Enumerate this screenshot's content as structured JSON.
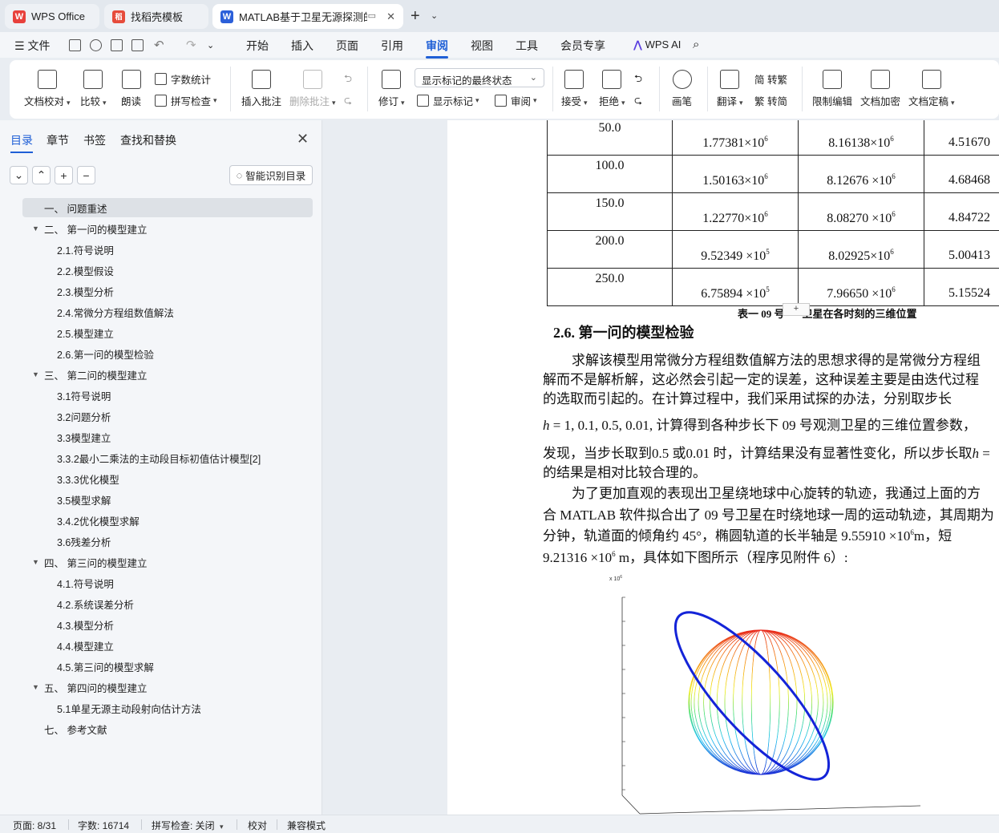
{
  "tabs": [
    {
      "label": "WPS Office",
      "logo": "W"
    },
    {
      "label": "找稻壳模板",
      "logo": "稻"
    },
    {
      "label": "MATLAB基于卫星无源探测的空...",
      "logo": "W"
    }
  ],
  "menu": {
    "file": "文件",
    "items": [
      "开始",
      "插入",
      "页面",
      "引用",
      "审阅",
      "视图",
      "工具",
      "会员专享"
    ],
    "active": "审阅",
    "ai": "WPS AI"
  },
  "ribbon": {
    "doc_check": "文档校对",
    "compare": "比较",
    "read_aloud": "朗读",
    "word_count": "字数统计",
    "spell_check": "拼写检查",
    "insert_comment": "插入批注",
    "delete_comment": "删除批注",
    "revise": "修订",
    "markup_select": "显示标记的最终状态",
    "show_markup": "显示标记",
    "review": "审阅",
    "accept": "接受",
    "reject": "拒绝",
    "pen": "画笔",
    "translate": "翻译",
    "to_traditional": "简 转繁",
    "to_simplified": "繁 转简",
    "restrict_edit": "限制编辑",
    "encrypt": "文档加密",
    "finalize": "文档定稿"
  },
  "sidebar": {
    "tabs": [
      "目录",
      "章节",
      "书签",
      "查找和替换"
    ],
    "smart_toc": "智能识别目录",
    "toc": [
      {
        "label": "一、 问题重述",
        "level": 1,
        "caret": false,
        "selected": true
      },
      {
        "label": "二、 第一问的模型建立",
        "level": 1,
        "caret": true
      },
      {
        "label": "2.1.符号说明",
        "level": 2
      },
      {
        "label": "2.2.模型假设",
        "level": 2
      },
      {
        "label": "2.3.模型分析",
        "level": 2
      },
      {
        "label": "2.4.常微分方程组数值解法",
        "level": 2
      },
      {
        "label": "2.5.模型建立",
        "level": 2
      },
      {
        "label": "2.6.第一问的模型检验",
        "level": 2
      },
      {
        "label": "三、 第二问的模型建立",
        "level": 1,
        "caret": true
      },
      {
        "label": "3.1符号说明",
        "level": 2
      },
      {
        "label": "3.2问题分析",
        "level": 2
      },
      {
        "label": "3.3模型建立",
        "level": 2
      },
      {
        "label": "3.3.2最小二乘法的主动段目标初值估计模型[2]",
        "level": 2
      },
      {
        "label": "3.3.3优化模型",
        "level": 2
      },
      {
        "label": "3.5模型求解",
        "level": 2
      },
      {
        "label": "3.4.2优化模型求解",
        "level": 2
      },
      {
        "label": "3.6残差分析",
        "level": 2
      },
      {
        "label": "四、 第三问的模型建立",
        "level": 1,
        "caret": true
      },
      {
        "label": "4.1.符号说明",
        "level": 2
      },
      {
        "label": "4.2.系统误差分析",
        "level": 2
      },
      {
        "label": "4.3.模型分析",
        "level": 2
      },
      {
        "label": "4.4.模型建立",
        "level": 2
      },
      {
        "label": "4.5.第三问的模型求解",
        "level": 2
      },
      {
        "label": "五、 第四问的模型建立",
        "level": 1,
        "caret": true
      },
      {
        "label": "5.1单星无源主动段射向估计方法",
        "level": 2
      },
      {
        "label": "七、 参考文献",
        "level": 1,
        "caret": false
      }
    ]
  },
  "table": {
    "rows": [
      {
        "step": "50.0",
        "v1": "1.77381×10",
        "e1": "6",
        "v2": "8.16138×10",
        "e2": "6",
        "v3": "4.51670"
      },
      {
        "step": "100.0",
        "v1": "1.50163×10",
        "e1": "6",
        "v2": "8.12676 ×10",
        "e2": "6",
        "v3": "4.68468"
      },
      {
        "step": "150.0",
        "v1": "1.22770×10",
        "e1": "6",
        "v2": "8.08270 ×10",
        "e2": "6",
        "v3": "4.84722"
      },
      {
        "step": "200.0",
        "v1": "9.52349 ×10",
        "e1": "5",
        "v2": "8.02925×10",
        "e2": "6",
        "v3": "5.00413"
      },
      {
        "step": "250.0",
        "v1": "6.75894 ×10",
        "e1": "5",
        "v2": "7.96650 ×10",
        "e2": "6",
        "v3": "5.15524"
      }
    ],
    "caption_a": "表一 09 号",
    "caption_b": "卫星在各时刻的三维位置"
  },
  "doc": {
    "heading": "2.6. 第一问的模型检验",
    "p1": "求解该模型用常微分方程组数值解方法的思想求得的是常微分方程组",
    "p2": "解而不是解析解，这必然会引起一定的误差，这种误差主要是由迭代过程",
    "p3": "的选取而引起的。在计算过程中，我们采用试探的办法，分别取步长",
    "p4a": "h",
    "p4b": " = 1, 0.1, 0.5, 0.01, 计算得到各种步长下 09 号观测卫星的三维位置参数，",
    "p5a": "发现，当步长取到0.5 或0.01 时，计算结果没有显著性变化，所以步长取",
    "p5b": "h",
    "p5c": " =",
    "p6": "的结果是相对比较合理的。",
    "p7": "为了更加直观的表现出卫星绕地球中心旋转的轨迹，我通过上面的方",
    "p8": "合 MATLAB 软件拟合出了 09 号卫星在时绕地球一周的运动轨迹，其周期为",
    "p9a": "分钟，轨道面的倾角约 45°，椭圆轨道的长半轴是 9.55910 ×10",
    "p9e": "6",
    "p9b": "m，短",
    "p10a": "9.21316 ×10",
    "p10e": "6",
    "p10b": " m，具体如下图所示（程序见附件 6）:"
  },
  "chart": {
    "axis_exp": "x 10",
    "exp_sup": "6"
  },
  "status": {
    "page": "页面: 8/31",
    "words": "字数: 16714",
    "spell": "拼写检查: 关闭",
    "proof": "校对",
    "compat": "兼容模式"
  },
  "colors": {
    "accent": "#1f5fd6",
    "wps_red": "#e8413c",
    "docer_red": "#e64b3b",
    "word_blue": "#2b5fd9"
  }
}
